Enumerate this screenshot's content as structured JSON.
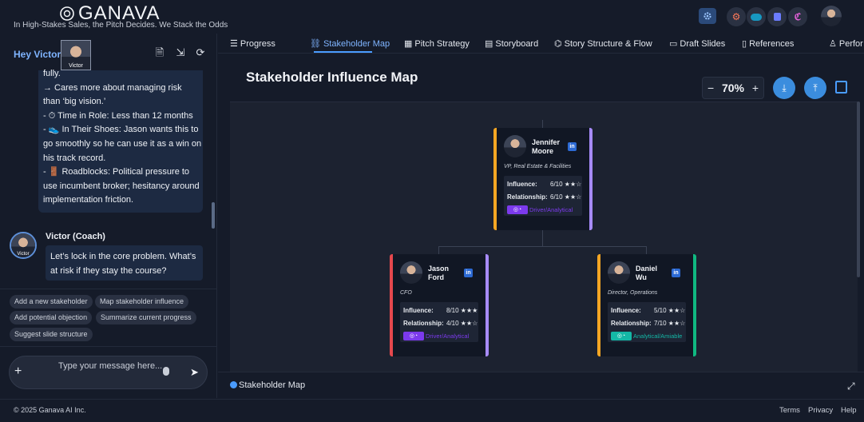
{
  "brand": {
    "name": "GANAVA",
    "tagline": "In High-Stakes Sales, the Pitch Decides. We Stack the Odds"
  },
  "left": {
    "greeting": "Hey Victor",
    "avatar_label": "Victor",
    "message_lines": [
      "fully.",
      "  → Cares more about managing risk",
      "than ‘big vision.’",
      "- ⏱ Time in Role: Less than 12 months",
      "- 👟 In Their Shoes: Jason wants this to",
      "go smoothly so he can use it as a win on",
      "his track record.",
      "- 🚪 Roadblocks: Political pressure to",
      "use incumbent broker; hesitancy around",
      "implementation friction."
    ],
    "coach_name": "Victor (Coach)",
    "coach_avatar_label": "Victor",
    "coach_message": "Let’s lock in the core problem. What’s at risk if they stay the course?",
    "chips": [
      "Add a new stakeholder",
      "Map stakeholder influence",
      "Add potential objection",
      "Summarize current progress",
      "Suggest slide structure"
    ],
    "input_placeholder": "Type your message here..."
  },
  "tabs": [
    "Progress",
    "Stakeholder Map",
    "Pitch Strategy",
    "Storyboard",
    "Story Structure & Flow",
    "Draft Slides",
    "References",
    "Perfor"
  ],
  "main": {
    "title": "Stakeholder Influence Map",
    "zoom": "70%",
    "footer_label": "Stakeholder Map"
  },
  "stakeholders": [
    {
      "first": "Jennifer",
      "last": "Moore",
      "role": "VP, Real Estate & Facilities",
      "influence_label": "Influence:",
      "influence": "6/10 ★★☆",
      "relationship_label": "Relationship:",
      "relationship": "6/10 ★★☆",
      "style": "Driver/Analytical",
      "left_color": "#f5a623",
      "right_color": "#a78bfa",
      "badge_color": "#7c3aed"
    },
    {
      "first": "Jason",
      "last": "Ford",
      "role": "CFO",
      "influence_label": "Influence:",
      "influence": "8/10 ★★★",
      "relationship_label": "Relationship:",
      "relationship": "4/10 ★★☆",
      "style": "Driver/Analytical",
      "left_color": "#e5484d",
      "right_color": "#a78bfa",
      "badge_color": "#7c3aed"
    },
    {
      "first": "Daniel",
      "last": "Wu",
      "role": "Director, Operations",
      "influence_label": "Influence:",
      "influence": "5/10 ★★☆",
      "relationship_label": "Relationship:",
      "relationship": "7/10 ★★☆",
      "style": "Analytical/Amiable",
      "left_color": "#f5a623",
      "right_color": "#10b981",
      "badge_color": "#14b8a6"
    }
  ],
  "footer": {
    "copyright": "© 2025 Ganava AI Inc.",
    "links": [
      "Terms",
      "Privacy",
      "Help"
    ]
  }
}
